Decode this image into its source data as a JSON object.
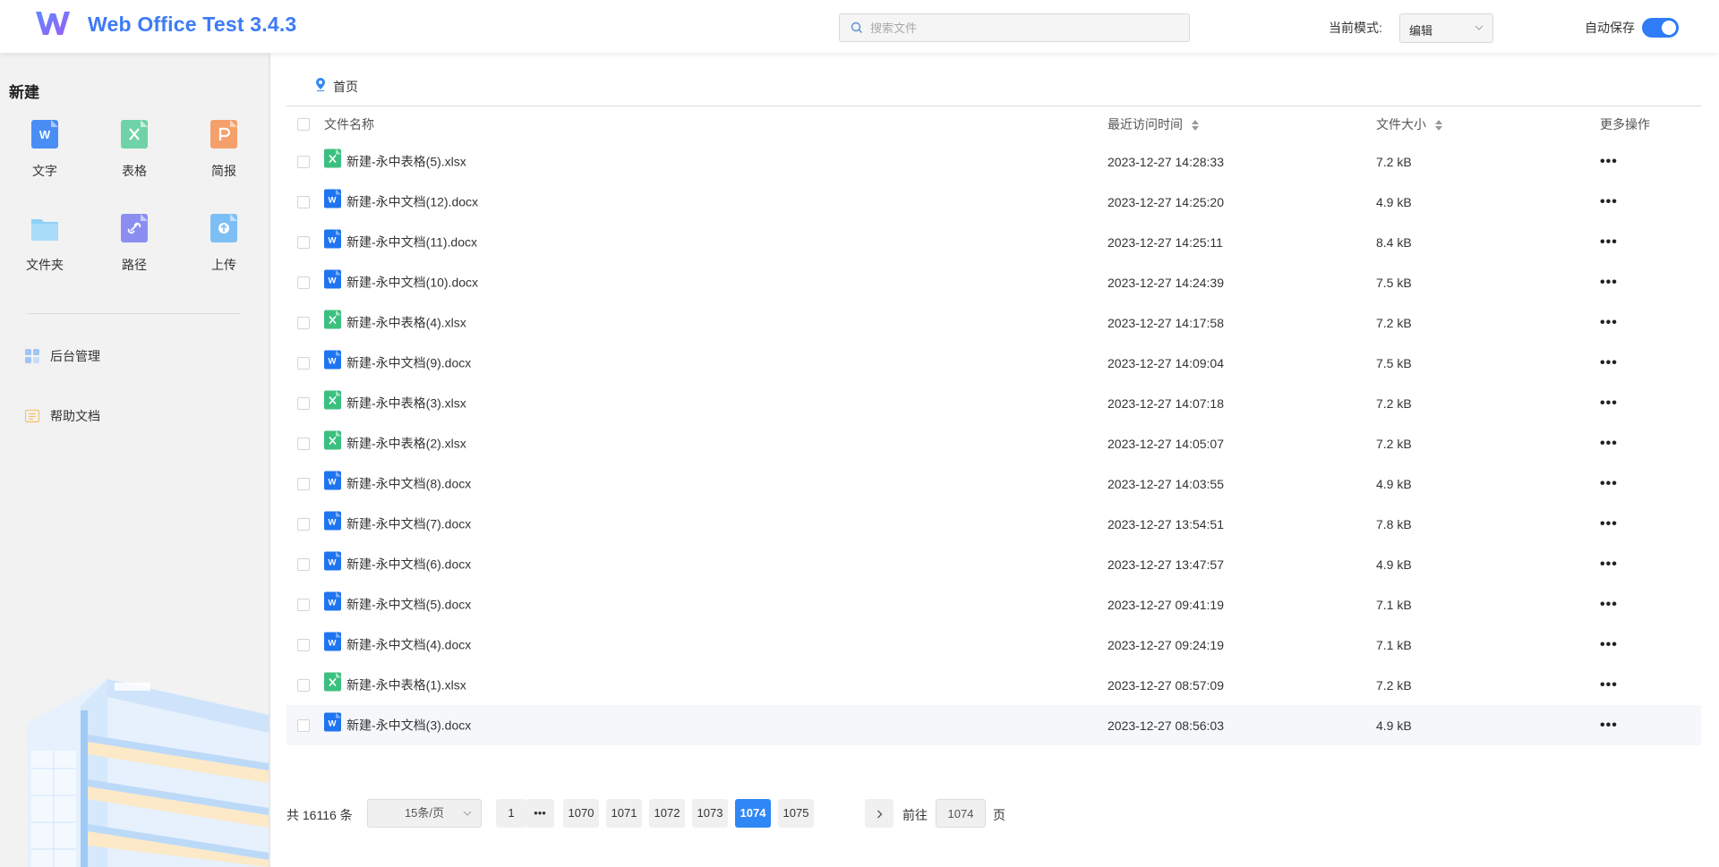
{
  "header": {
    "title": "Web Office Test 3.4.3",
    "search_placeholder": "搜索文件",
    "mode_label": "当前模式:",
    "mode_value": "编辑",
    "autosave_label": "自动保存",
    "autosave_on": true
  },
  "sidebar": {
    "heading": "新建",
    "new_items": [
      {
        "label": "文字",
        "icon": "word-doc-icon",
        "color": "#4a8ef5"
      },
      {
        "label": "表格",
        "icon": "spreadsheet-icon",
        "color": "#6fd3a7"
      },
      {
        "label": "简报",
        "icon": "presentation-icon",
        "color": "#f5a06b"
      },
      {
        "label": "文件夹",
        "icon": "folder-icon",
        "color": "#8fd0f5"
      },
      {
        "label": "路径",
        "icon": "link-icon",
        "color": "#8b8ef0"
      },
      {
        "label": "上传",
        "icon": "upload-icon",
        "color": "#7dbff5"
      }
    ],
    "links": [
      {
        "label": "后台管理",
        "icon": "dashboard-icon"
      },
      {
        "label": "帮助文档",
        "icon": "help-doc-icon"
      }
    ]
  },
  "breadcrumb": {
    "home": "首页"
  },
  "table": {
    "columns": {
      "name": "文件名称",
      "time": "最近访问时间",
      "size": "文件大小",
      "more": "更多操作"
    },
    "rows": [
      {
        "type": "xlsx",
        "name": "新建-永中表格(5).xlsx",
        "time": "2023-12-27 14:28:33",
        "size": "7.2 kB"
      },
      {
        "type": "docx",
        "name": "新建-永中文档(12).docx",
        "time": "2023-12-27 14:25:20",
        "size": "4.9 kB"
      },
      {
        "type": "docx",
        "name": "新建-永中文档(11).docx",
        "time": "2023-12-27 14:25:11",
        "size": "8.4 kB"
      },
      {
        "type": "docx",
        "name": "新建-永中文档(10).docx",
        "time": "2023-12-27 14:24:39",
        "size": "7.5 kB"
      },
      {
        "type": "xlsx",
        "name": "新建-永中表格(4).xlsx",
        "time": "2023-12-27 14:17:58",
        "size": "7.2 kB"
      },
      {
        "type": "docx",
        "name": "新建-永中文档(9).docx",
        "time": "2023-12-27 14:09:04",
        "size": "7.5 kB"
      },
      {
        "type": "xlsx",
        "name": "新建-永中表格(3).xlsx",
        "time": "2023-12-27 14:07:18",
        "size": "7.2 kB"
      },
      {
        "type": "xlsx",
        "name": "新建-永中表格(2).xlsx",
        "time": "2023-12-27 14:05:07",
        "size": "7.2 kB"
      },
      {
        "type": "docx",
        "name": "新建-永中文档(8).docx",
        "time": "2023-12-27 14:03:55",
        "size": "4.9 kB"
      },
      {
        "type": "docx",
        "name": "新建-永中文档(7).docx",
        "time": "2023-12-27 13:54:51",
        "size": "7.8 kB"
      },
      {
        "type": "docx",
        "name": "新建-永中文档(6).docx",
        "time": "2023-12-27 13:47:57",
        "size": "4.9 kB"
      },
      {
        "type": "docx",
        "name": "新建-永中文档(5).docx",
        "time": "2023-12-27 09:41:19",
        "size": "7.1 kB"
      },
      {
        "type": "docx",
        "name": "新建-永中文档(4).docx",
        "time": "2023-12-27 09:24:19",
        "size": "7.1 kB"
      },
      {
        "type": "xlsx",
        "name": "新建-永中表格(1).xlsx",
        "time": "2023-12-27 08:57:09",
        "size": "7.2 kB"
      },
      {
        "type": "docx",
        "name": "新建-永中文档(3).docx",
        "time": "2023-12-27 08:56:03",
        "size": "4.9 kB"
      }
    ],
    "more_glyph": "•••"
  },
  "pagination": {
    "total": "共 16116 条",
    "page_size": "15条/页",
    "pages": [
      "1",
      "•••",
      "1070",
      "1071",
      "1072",
      "1073",
      "1074",
      "1075"
    ],
    "current": "1074",
    "goto_label": "前往",
    "goto_value": "1074",
    "page_unit": "页"
  }
}
